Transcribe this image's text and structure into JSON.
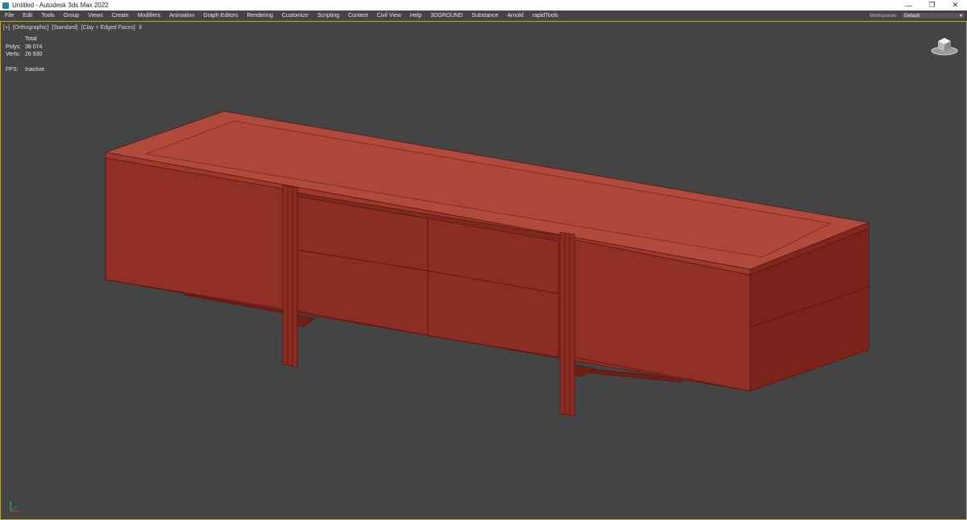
{
  "window": {
    "title": "Untitled - Autodesk 3ds Max 2022",
    "buttons": [
      "—",
      "❐",
      "✕"
    ]
  },
  "menubar": {
    "items": [
      "File",
      "Edit",
      "Tools",
      "Group",
      "Views",
      "Create",
      "Modifiers",
      "Animation",
      "Graph Editors",
      "Rendering",
      "Customize",
      "Scripting",
      "Content",
      "Civil View",
      "Help",
      "3DGROUND",
      "Substance",
      "Arnold",
      "rapidTools"
    ],
    "workspace_label": "Workspaces:",
    "workspace_value": "Default"
  },
  "viewport": {
    "label_parts": [
      "[+]",
      "[Orthographic]",
      "[Standard]",
      "[Clay + Edged Faces]"
    ],
    "filter_icon": "funnel-icon",
    "stats": {
      "header": "Total",
      "polys_label": "Polys:",
      "polys_value": "38 074",
      "verts_label": "Verts:",
      "verts_value": "26 930",
      "fps_label": "FPS:",
      "fps_value": "Inactive"
    }
  },
  "colors": {
    "viewport_bg": "#444444",
    "model_top": "#b04a3c",
    "model_front": "#8e2f25",
    "model_side": "#7a231b",
    "active_border": "#b3a84e"
  }
}
